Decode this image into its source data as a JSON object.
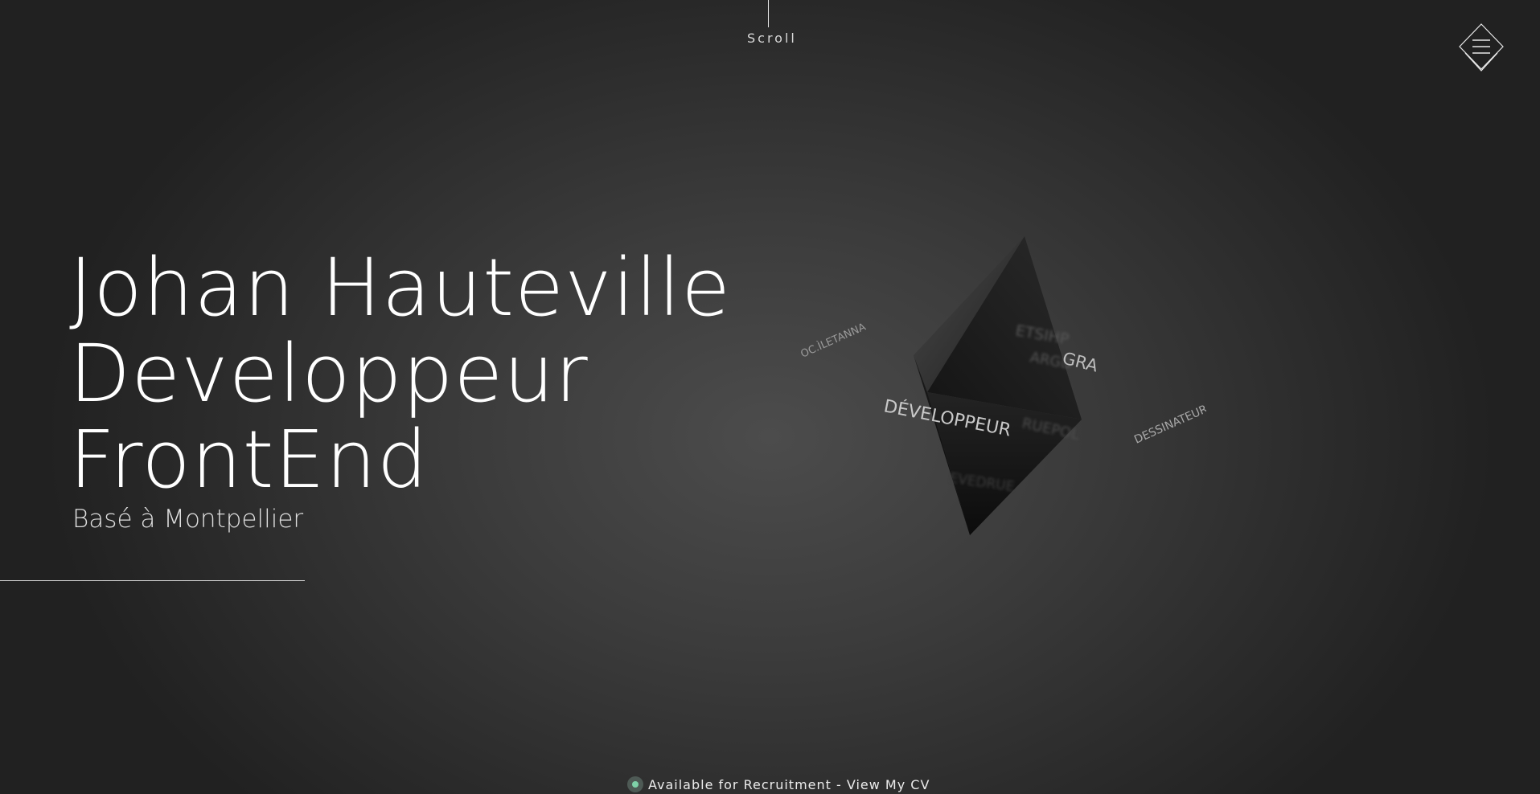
{
  "scroll": {
    "label": "Scroll"
  },
  "menu": {
    "icon": "hamburger-diamond-icon"
  },
  "hero": {
    "line1": "Johan Hauteville",
    "line2": "Developpeur",
    "line3": "FrontEnd",
    "subtitle": "Basé à Montpellier"
  },
  "scene": {
    "words": {
      "developpeur": "DÉVELOPPEUR",
      "graphiste": "GRA",
      "dessinateur": "DESSINATEUR",
      "left_word": "OC.ÌLETANNA"
    }
  },
  "status": {
    "text": "Available for Recruitment - View My CV",
    "dot_color": "#7ed1a8"
  }
}
